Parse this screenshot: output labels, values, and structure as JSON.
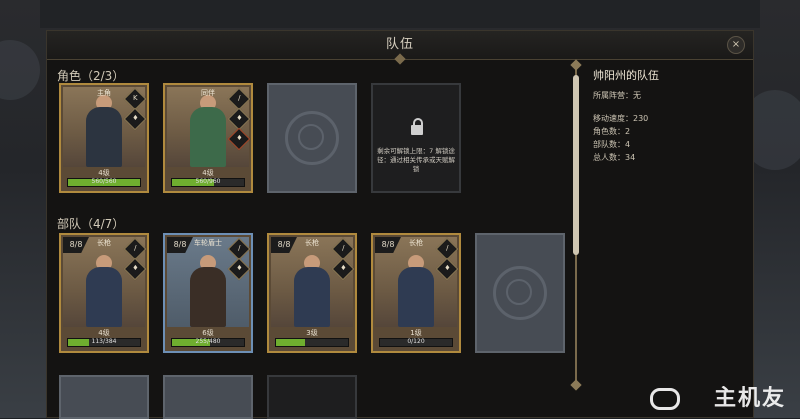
{
  "window": {
    "title": "队伍",
    "close_symbol": "×"
  },
  "sections": {
    "characters_label": "角色（2/3）",
    "troops_label": "部队（4/7）"
  },
  "characters": [
    {
      "name": "主角",
      "level": "4级",
      "xp": "560/560",
      "xp_fraction": 1.0,
      "badges": [
        "K",
        "♦"
      ]
    },
    {
      "name": "同伴",
      "level": "4级",
      "xp": "560/960",
      "xp_fraction": 0.58,
      "badges": [
        "/",
        "♦",
        "♦"
      ]
    }
  ],
  "locked_slot": {
    "text": "剩余可解锁上限：7 解锁途径：通过相关传承或天赋解锁"
  },
  "troops": [
    {
      "rank": "8/8",
      "name": "长枪",
      "level": "4级",
      "xp": "113/384",
      "xp_fraction": 0.29,
      "border": "gold"
    },
    {
      "rank": "8/8",
      "name": "车轮盾士",
      "level": "6级",
      "xp": "255/480",
      "xp_fraction": 0.53,
      "border": "blue"
    },
    {
      "rank": "8/8",
      "name": "长枪",
      "level": "3级",
      "xp": "",
      "xp_fraction": 0.4,
      "border": "gold"
    },
    {
      "rank": "8/8",
      "name": "长枪",
      "level": "1级",
      "xp": "0/120",
      "xp_fraction": 0.0,
      "border": "gold"
    }
  ],
  "info": {
    "team_title": "帅阳州的队伍",
    "camp": "所属阵营：无",
    "speed": "移动速度：230",
    "char_count": "角色数：2",
    "troop_count": "部队数：4",
    "total": "总人数：34"
  },
  "watermark": "主机友",
  "colors": {
    "gold_border": "#b08a3e",
    "blue_border": "#6d8fb5",
    "xp_fill": "#6fae2f"
  }
}
